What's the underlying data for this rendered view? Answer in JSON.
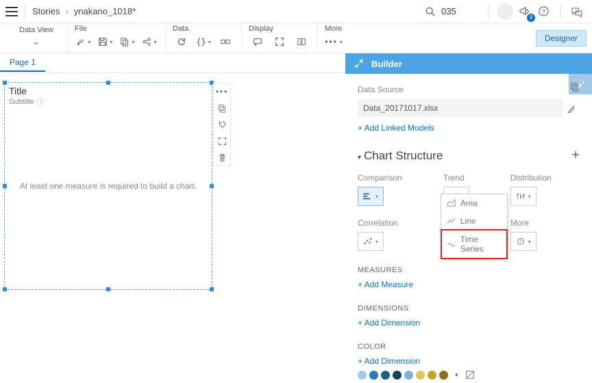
{
  "breadcrumb": {
    "root": "Stories",
    "current": "ynakano_1018*"
  },
  "search": {
    "value": "035"
  },
  "notifications": {
    "count": "9"
  },
  "dataView": {
    "label": "Data View"
  },
  "toolbar": {
    "file": "File",
    "data": "Data",
    "display": "Display",
    "more": "More"
  },
  "designer": {
    "label": "Designer"
  },
  "tabs": {
    "page1": "Page 1"
  },
  "chartWidget": {
    "title": "Title",
    "subtitle": "Subtitle",
    "emptyMsg": "At least one measure is required to build a chart."
  },
  "builder": {
    "title": "Builder",
    "dataSourceLabel": "Data Source",
    "dataSourceName": "Data_20171017.xlsx",
    "addLinked": "+ Add Linked Models",
    "chartStructure": "Chart Structure",
    "categories": {
      "comparison": "Comparison",
      "correlation": "Correlation",
      "trend": "Trend",
      "distribution": "Distribution",
      "more": "More"
    },
    "trendMenu": {
      "area": "Area",
      "line": "Line",
      "timeSeries": "Time Series"
    },
    "measures": {
      "head": "MEASURES",
      "add": "+ Add Measure"
    },
    "dimensions": {
      "head": "DIMENSIONS",
      "add": "+ Add Dimension"
    },
    "color": {
      "head": "COLOR",
      "add": "+ Add Dimension"
    }
  },
  "colorSwatches": [
    "#9fc9e6",
    "#227fbb",
    "#1a5e8a",
    "#134561",
    "#78b6d9",
    "#e5c55a",
    "#c8a12e",
    "#8a6f1c"
  ]
}
